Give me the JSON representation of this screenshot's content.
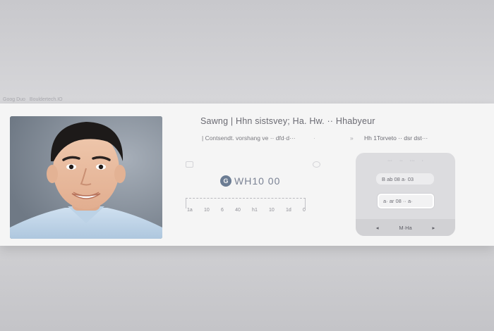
{
  "window": {
    "tabs": [
      "Goog Duo",
      "Bouldertech.IO"
    ]
  },
  "profile_card": {
    "headline": "Sawng | Hhn sistsvey; Ha. Hw. ·· Hhabyeur",
    "subline": "| Contsendt. vorshang ve ·· dfd·d···",
    "subline_trail": "·",
    "brand_logo": "G",
    "brand_name": "WH10 00",
    "timeline_ticks": [
      "1a",
      "10",
      "6",
      "40",
      "h1",
      "10",
      "1d",
      "0"
    ]
  },
  "side_panel": {
    "arrow": "»",
    "title": "Hh 1Torveto ·· dsr dst···",
    "header_items": [
      "···",
      "··",
      "···",
      "·"
    ],
    "chip_primary": "B  ab 08 a· 03",
    "chip_selected": "a· ar 08 ·· a·",
    "footer_left": "◂",
    "footer_label": "M·Ha",
    "footer_right": "▸"
  },
  "colors": {
    "card_bg": "#f5f5f5",
    "panel_bg": "#dcdcdf",
    "brand_text": "#7a8294",
    "brand_logo": "#6b7c93"
  }
}
